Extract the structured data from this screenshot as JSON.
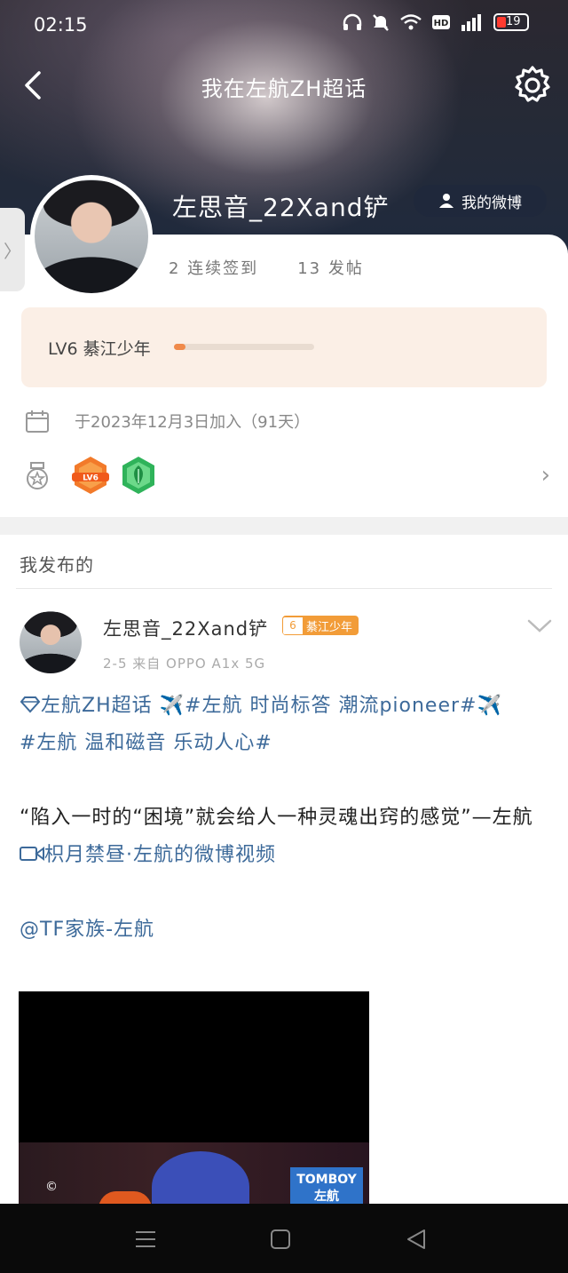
{
  "status_bar": {
    "time": "02:15",
    "battery": "19"
  },
  "header": {
    "title": "我在左航ZH超话"
  },
  "profile": {
    "username": "左思音_22Xand铲",
    "my_weibo_label": "我的微博",
    "stats": {
      "checkin": "2 连续签到",
      "posts": "13 发帖"
    },
    "level": {
      "label": "LV6 綦江少年",
      "progress_fraction": 0.08
    },
    "join_text": "于2023年12月3日加入（91天）",
    "badges": [
      "LV6-badge",
      "leaf-badge"
    ]
  },
  "section": {
    "title": "我发布的"
  },
  "post": {
    "author": "左思音_22Xand铲",
    "rank_level": "6",
    "rank_name": "綦江少年",
    "meta": "2-5  来自 OPPO A1x 5G",
    "lines": {
      "topic_link": "左航ZH超话",
      "tag1": "✈️#左航 时尚标答 潮流pioneer#✈️",
      "tag2": "#左航 温和磁音 乐动人心#",
      "quote": "“陷入一时的“困境”就会给人一种灵魂出窍的感觉”—左航",
      "video_link": "枳月禁昼·左航的微博视频",
      "mention": "@TF家族-左航"
    },
    "video": {
      "copyright": "©",
      "brand": "TOMBOY 左航"
    }
  },
  "colors": {
    "link": "#3d6a9a",
    "accent_orange": "#f08a4b",
    "level_bg": "#fbefe6"
  }
}
